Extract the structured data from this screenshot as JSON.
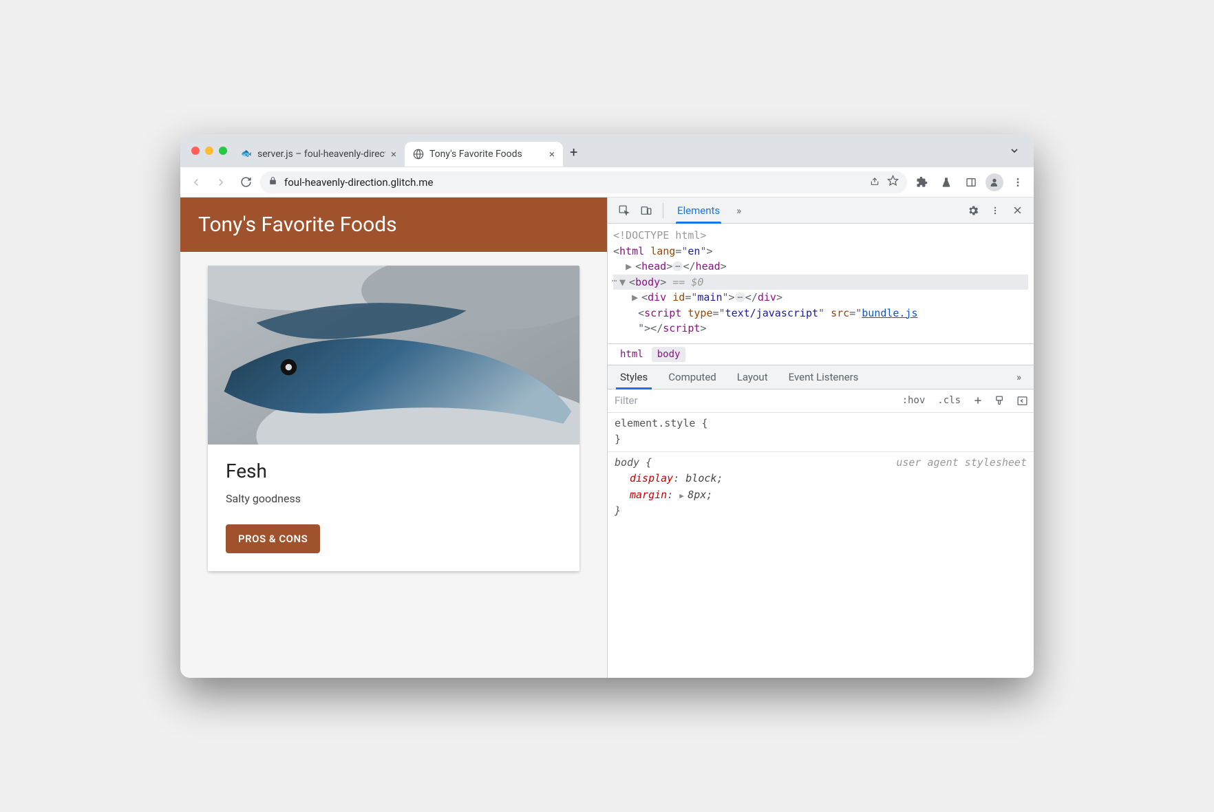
{
  "tabs": [
    {
      "title": "server.js – foul-heavenly-direct",
      "active": false
    },
    {
      "title": "Tony's Favorite Foods",
      "active": true
    }
  ],
  "address_bar": {
    "url": "foul-heavenly-direction.glitch.me"
  },
  "page": {
    "header": "Tony's Favorite Foods",
    "card": {
      "title": "Fesh",
      "subtitle": "Salty goodness",
      "button": "PROS & CONS"
    }
  },
  "devtools": {
    "toolbar": {
      "active_panel": "Elements",
      "more": "»"
    },
    "dom": {
      "doctype": "<!DOCTYPE html>",
      "html_open": "<html lang=\"en\">",
      "head": {
        "open": "<head>",
        "close": "</head>"
      },
      "body_open": "<body>",
      "body_eq": " == $0",
      "div": {
        "open": "<div id=\"main\">",
        "close": "</div>"
      },
      "script": {
        "open_pre": "<script type=\"text/javascript\" src=\"",
        "src": "bundle.js",
        "open_post": "\">",
        "close": "</script>"
      }
    },
    "breadcrumbs": [
      "html",
      "body"
    ],
    "styles_tabs": [
      "Styles",
      "Computed",
      "Layout",
      "Event Listeners"
    ],
    "styles_more": "»",
    "filter_placeholder": "Filter",
    "filter_buttons": {
      "hov": ":hov",
      "cls": ".cls"
    },
    "styles": {
      "element_style": "element.style {",
      "close_brace": "}",
      "body_rule": {
        "selector": "body {",
        "source": "user agent stylesheet",
        "props": [
          {
            "name": "display",
            "value": "block"
          },
          {
            "name": "margin",
            "value": "8px"
          }
        ]
      }
    }
  }
}
